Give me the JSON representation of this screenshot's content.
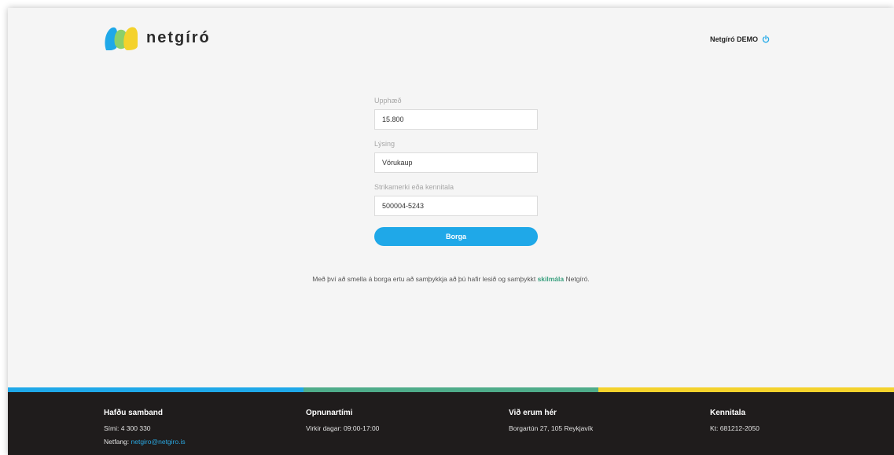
{
  "header": {
    "brand": "netgíró",
    "user_name": "Netgíró DEMO"
  },
  "form": {
    "amount_label": "Upphæð",
    "amount_value": "15.800",
    "description_label": "Lýsing",
    "description_value": "Vörukaup",
    "barcode_label": "Strikamerki eða kennitala",
    "barcode_value": "500004-5243",
    "pay_label": "Borga"
  },
  "terms": {
    "before": "Með því að smella á borga ertu að samþykkja að þú hafir lesið og samþykkt ",
    "link": "skilmála",
    "after": " Netgíró."
  },
  "footer": {
    "contact": {
      "heading": "Hafðu samband",
      "phone": "Sími: 4 300 330",
      "email_prefix": "Netfang: ",
      "email": "netgiro@netgiro.is"
    },
    "hours": {
      "heading": "Opnunartími",
      "text": "Virkir dagar: 09:00-17:00"
    },
    "location": {
      "heading": "Við erum hér",
      "text": "Borgartún 27, 105 Reykjavík"
    },
    "id": {
      "heading": "Kennitala",
      "text": "Kt: 681212-2050"
    }
  },
  "colors": {
    "blue": "#1fa8e8",
    "green": "#4fac8a",
    "yellow": "#f4d22c",
    "footer_bg": "#1f1c1c",
    "terms_link": "#3aa07f"
  },
  "icons": {
    "logo": "netgiro-logo-icon",
    "power": "power-icon"
  }
}
